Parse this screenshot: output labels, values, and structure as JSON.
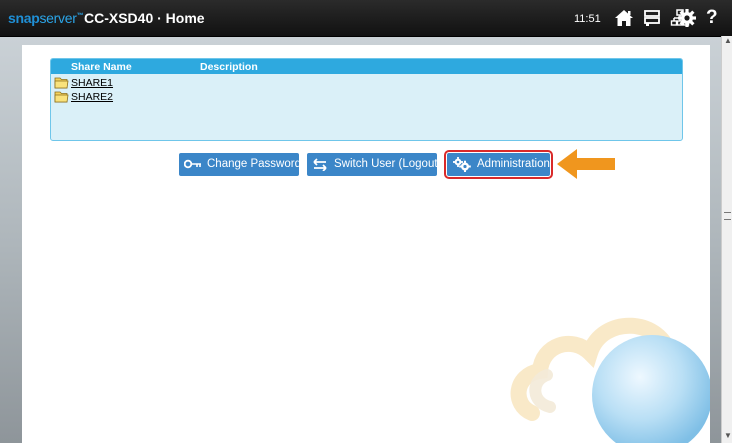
{
  "header": {
    "logo_snap": "snap",
    "logo_server": "server",
    "logo_tm": "™",
    "title": "CC-XSD40 · Home",
    "time": "11:51",
    "icons": [
      "home-icon",
      "storage-icon",
      "network-icon",
      "gear-icon",
      "help-icon"
    ],
    "help_glyph": "?"
  },
  "shares": {
    "columns": [
      "Share Name",
      "Description"
    ],
    "rows": [
      {
        "name": "SHARE1",
        "description": ""
      },
      {
        "name": "SHARE2",
        "description": ""
      }
    ]
  },
  "buttons": {
    "change_password": "Change Password",
    "switch_user": "Switch User (Logout)",
    "administration": "Administration"
  },
  "colors": {
    "header_bg": "#1a1a1a",
    "accent_blue": "#2ea9df",
    "button_blue": "#3b86c8",
    "highlight_red": "#d92a2a",
    "arrow_orange": "#f0961e"
  }
}
